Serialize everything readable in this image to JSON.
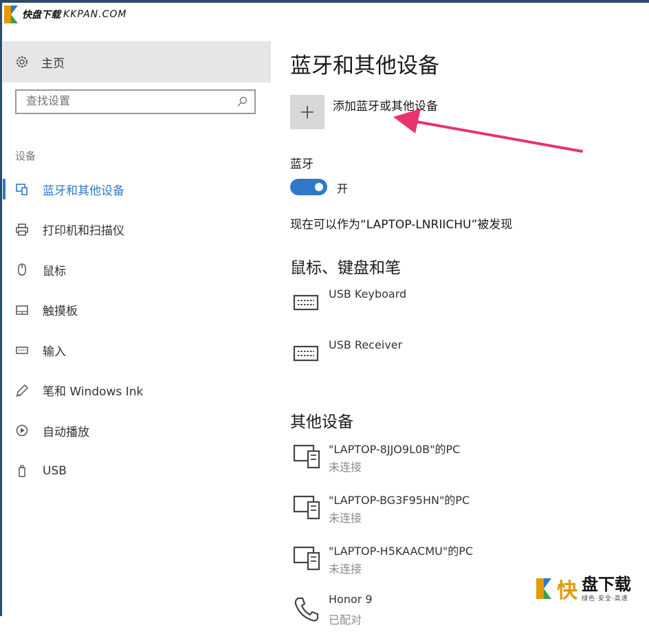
{
  "watermark": {
    "top_text": "快盘下载",
    "top_url": "KKPAN.COM",
    "bottom_big": "快",
    "bottom_title": "盘下载",
    "bottom_tag": "绿色·安全·高速"
  },
  "sidebar": {
    "home_label": "主页",
    "search_placeholder": "查找设置",
    "section_label": "设备",
    "items": [
      {
        "label": "蓝牙和其他设备",
        "icon": "bluetooth-devices-icon",
        "active": true
      },
      {
        "label": "打印机和扫描仪",
        "icon": "printer-icon"
      },
      {
        "label": "鼠标",
        "icon": "mouse-icon"
      },
      {
        "label": "触摸板",
        "icon": "touchpad-icon"
      },
      {
        "label": "输入",
        "icon": "keyboard-icon"
      },
      {
        "label": "笔和 Windows Ink",
        "icon": "pen-icon"
      },
      {
        "label": "自动播放",
        "icon": "autoplay-icon"
      },
      {
        "label": "USB",
        "icon": "usb-icon"
      }
    ]
  },
  "main": {
    "title": "蓝牙和其他设备",
    "add_label": "添加蓝牙或其他设备",
    "bluetooth_heading": "蓝牙",
    "bluetooth_state": "开",
    "discoverable_text": "现在可以作为“LAPTOP-LNRIICHU”被发现",
    "mouse_keyboard_heading": "鼠标、键盘和笔",
    "input_devices": [
      {
        "name": "USB Keyboard"
      },
      {
        "name": "USB Receiver"
      }
    ],
    "other_heading": "其他设备",
    "other_devices": [
      {
        "name": "\"LAPTOP-8JJO9L0B\"的PC",
        "status": "未连接"
      },
      {
        "name": "\"LAPTOP-BG3F95HN\"的PC",
        "status": "未连接"
      },
      {
        "name": "\"LAPTOP-H5KAACMU\"的PC",
        "status": "未连接"
      },
      {
        "name": "Honor 9",
        "status": "已配对"
      }
    ]
  },
  "colors": {
    "accent": "#2f79c8",
    "arrow": "#e8336b"
  }
}
